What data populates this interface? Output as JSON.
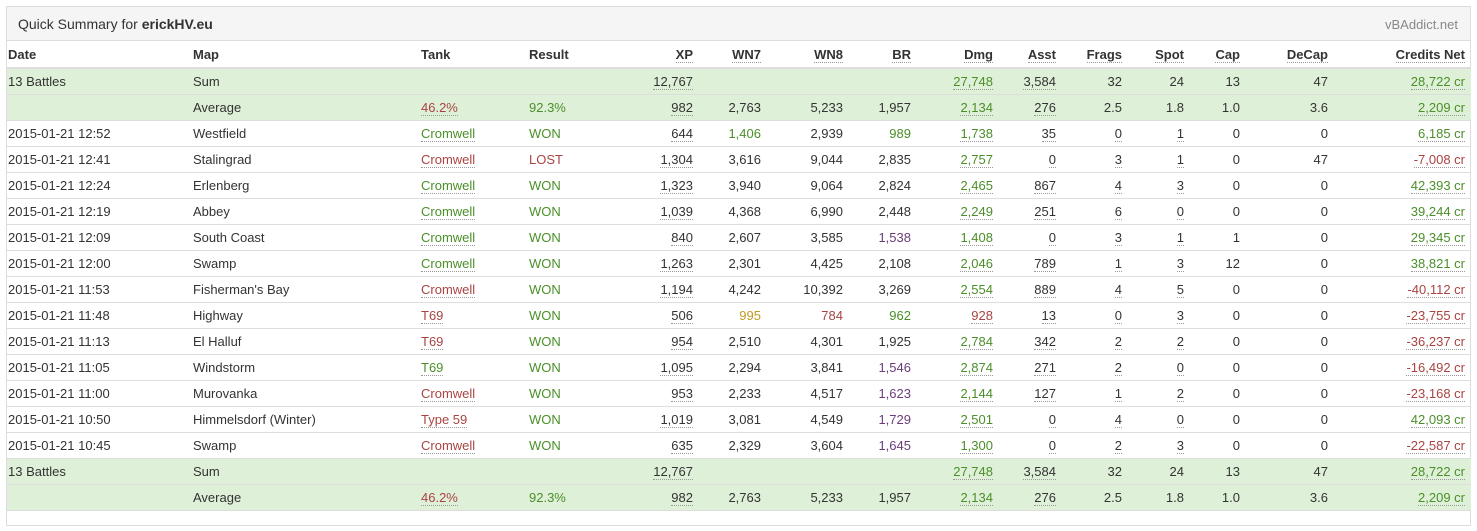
{
  "panel": {
    "title_prefix": "Quick Summary for ",
    "player": "erickHV.eu",
    "brand": "vBAddict.net"
  },
  "colors": {
    "green": "#4b8f29",
    "red": "#a94442",
    "orange": "#c09a1f",
    "purple": "#6a3d7a",
    "summary_bg": "#dff0d8"
  },
  "columns": [
    "Date",
    "Map",
    "Tank",
    "Result",
    "XP",
    "WN7",
    "WN8",
    "BR",
    "Dmg",
    "Asst",
    "Frags",
    "Spot",
    "Cap",
    "DeCap",
    "Credits Net"
  ],
  "summary": {
    "sum": {
      "label": "13 Battles",
      "map": "Sum",
      "tank": "",
      "result": "",
      "xp": "12,767",
      "wn7": "",
      "wn8": "",
      "br": "",
      "dmg": "27,748",
      "asst": "3,584",
      "frags": "32",
      "spot": "24",
      "cap": "13",
      "decap": "47",
      "credits": "28,722 cr"
    },
    "avg": {
      "label": "",
      "map": "Average",
      "tank": "46.2%",
      "result": "92.3%",
      "xp": "982",
      "wn7": "2,763",
      "wn8": "5,233",
      "br": "1,957",
      "dmg": "2,134",
      "asst": "276",
      "frags": "2.5",
      "spot": "1.8",
      "cap": "1.0",
      "decap": "3.6",
      "credits": "2,209 cr"
    }
  },
  "battles": [
    {
      "date": "2015-01-21 12:52",
      "map": "Westfield",
      "tank": "Cromwell",
      "result": "WON",
      "xp": "644",
      "wn7": "1,406",
      "wn8": "2,939",
      "br": "989",
      "dmg": "1,738",
      "asst": "35",
      "frags": "0",
      "spot": "1",
      "cap": "0",
      "decap": "0",
      "credits": "6,185 cr"
    },
    {
      "date": "2015-01-21 12:41",
      "map": "Stalingrad",
      "tank": "Cromwell",
      "result": "LOST",
      "xp": "1,304",
      "wn7": "3,616",
      "wn8": "9,044",
      "br": "2,835",
      "dmg": "2,757",
      "asst": "0",
      "frags": "3",
      "spot": "1",
      "cap": "0",
      "decap": "47",
      "credits": "-7,008 cr"
    },
    {
      "date": "2015-01-21 12:24",
      "map": "Erlenberg",
      "tank": "Cromwell",
      "result": "WON",
      "xp": "1,323",
      "wn7": "3,940",
      "wn8": "9,064",
      "br": "2,824",
      "dmg": "2,465",
      "asst": "867",
      "frags": "4",
      "spot": "3",
      "cap": "0",
      "decap": "0",
      "credits": "42,393 cr"
    },
    {
      "date": "2015-01-21 12:19",
      "map": "Abbey",
      "tank": "Cromwell",
      "result": "WON",
      "xp": "1,039",
      "wn7": "4,368",
      "wn8": "6,990",
      "br": "2,448",
      "dmg": "2,249",
      "asst": "251",
      "frags": "6",
      "spot": "0",
      "cap": "0",
      "decap": "0",
      "credits": "39,244 cr"
    },
    {
      "date": "2015-01-21 12:09",
      "map": "South Coast",
      "tank": "Cromwell",
      "result": "WON",
      "xp": "840",
      "wn7": "2,607",
      "wn8": "3,585",
      "br": "1,538",
      "dmg": "1,408",
      "asst": "0",
      "frags": "3",
      "spot": "1",
      "cap": "1",
      "decap": "0",
      "credits": "29,345 cr"
    },
    {
      "date": "2015-01-21 12:00",
      "map": "Swamp",
      "tank": "Cromwell",
      "result": "WON",
      "xp": "1,263",
      "wn7": "2,301",
      "wn8": "4,425",
      "br": "2,108",
      "dmg": "2,046",
      "asst": "789",
      "frags": "1",
      "spot": "3",
      "cap": "12",
      "decap": "0",
      "credits": "38,821 cr"
    },
    {
      "date": "2015-01-21 11:53",
      "map": "Fisherman's Bay",
      "tank": "Cromwell",
      "result": "WON",
      "xp": "1,194",
      "wn7": "4,242",
      "wn8": "10,392",
      "br": "3,269",
      "dmg": "2,554",
      "asst": "889",
      "frags": "4",
      "spot": "5",
      "cap": "0",
      "decap": "0",
      "credits": "-40,112 cr"
    },
    {
      "date": "2015-01-21 11:48",
      "map": "Highway",
      "tank": "T69",
      "result": "WON",
      "xp": "506",
      "wn7": "995",
      "wn8": "784",
      "br": "962",
      "dmg": "928",
      "asst": "13",
      "frags": "0",
      "spot": "3",
      "cap": "0",
      "decap": "0",
      "credits": "-23,755 cr"
    },
    {
      "date": "2015-01-21 11:13",
      "map": "El Halluf",
      "tank": "T69",
      "result": "WON",
      "xp": "954",
      "wn7": "2,510",
      "wn8": "4,301",
      "br": "1,925",
      "dmg": "2,784",
      "asst": "342",
      "frags": "2",
      "spot": "2",
      "cap": "0",
      "decap": "0",
      "credits": "-36,237 cr"
    },
    {
      "date": "2015-01-21 11:05",
      "map": "Windstorm",
      "tank": "T69",
      "result": "WON",
      "xp": "1,095",
      "wn7": "2,294",
      "wn8": "3,841",
      "br": "1,546",
      "dmg": "2,874",
      "asst": "271",
      "frags": "2",
      "spot": "0",
      "cap": "0",
      "decap": "0",
      "credits": "-16,492 cr"
    },
    {
      "date": "2015-01-21 11:00",
      "map": "Murovanka",
      "tank": "Cromwell",
      "result": "WON",
      "xp": "953",
      "wn7": "2,233",
      "wn8": "4,517",
      "br": "1,623",
      "dmg": "2,144",
      "asst": "127",
      "frags": "1",
      "spot": "2",
      "cap": "0",
      "decap": "0",
      "credits": "-23,168 cr"
    },
    {
      "date": "2015-01-21 10:50",
      "map": "Himmelsdorf (Winter)",
      "tank": "Type 59",
      "result": "WON",
      "xp": "1,019",
      "wn7": "3,081",
      "wn8": "4,549",
      "br": "1,729",
      "dmg": "2,501",
      "asst": "0",
      "frags": "4",
      "spot": "0",
      "cap": "0",
      "decap": "0",
      "credits": "42,093 cr"
    },
    {
      "date": "2015-01-21 10:45",
      "map": "Swamp",
      "tank": "Cromwell",
      "result": "WON",
      "xp": "635",
      "wn7": "2,329",
      "wn8": "3,604",
      "br": "1,645",
      "dmg": "1,300",
      "asst": "0",
      "frags": "2",
      "spot": "3",
      "cap": "0",
      "decap": "0",
      "credits": "-22,587 cr"
    }
  ],
  "cell_colors": {
    "tank": [
      "green",
      "red",
      "green",
      "green",
      "green",
      "green",
      "red",
      "red",
      "red",
      "green",
      "red",
      "red",
      "red"
    ],
    "wn7": [
      "green",
      "",
      "",
      "",
      "",
      "",
      "",
      "orange",
      "",
      "",
      "",
      "",
      ""
    ],
    "wn8": [
      "",
      "",
      "",
      "",
      "",
      "",
      "",
      "red",
      "",
      "",
      "",
      "",
      ""
    ],
    "br": [
      "green",
      "",
      "",
      "",
      "purple",
      "",
      "",
      "green",
      "",
      "purple",
      "purple",
      "purple",
      "purple"
    ],
    "dmg": [
      "green",
      "green",
      "green",
      "green",
      "green",
      "green",
      "green",
      "red",
      "green",
      "green",
      "green",
      "green",
      "green"
    ],
    "credits": [
      "green",
      "red",
      "green",
      "green",
      "green",
      "green",
      "red",
      "red",
      "red",
      "red",
      "red",
      "green",
      "red"
    ]
  }
}
